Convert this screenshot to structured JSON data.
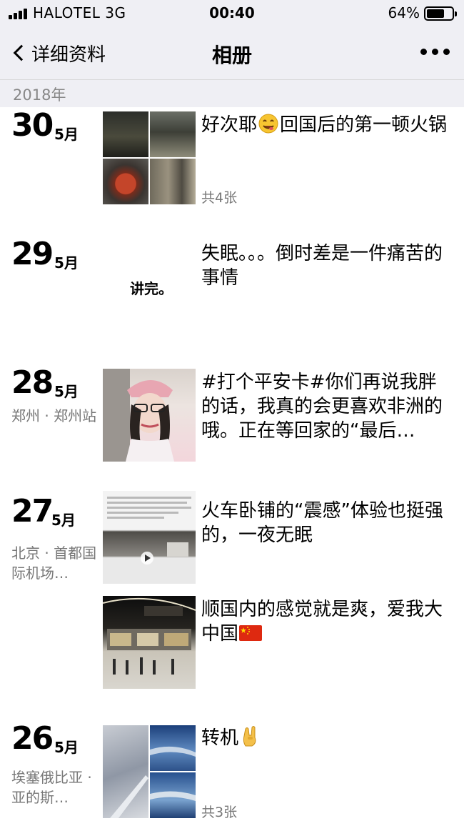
{
  "status_bar": {
    "carrier": "HALOTEL   3G",
    "time": "00:40",
    "battery": "64%"
  },
  "nav": {
    "back_label": "详细资料",
    "title": "相册"
  },
  "year": "2018年",
  "entries": [
    {
      "day": "30",
      "month": "5月",
      "location": "",
      "text": "好次耶",
      "text_after": "回国后的第一顿火锅",
      "count": "共4张"
    },
    {
      "day": "29",
      "month": "5月",
      "location": "",
      "text": "失眠。。。倒时差是一件痛苦的事情",
      "image_text": "讲完。"
    },
    {
      "day": "28",
      "month": "5月",
      "location": "郑州 · 郑州站",
      "text": "#打个平安卡#你们再说我胖的话，我真的会更喜欢非洲的哦。正在等回家的“最后…"
    },
    {
      "day": "27",
      "month": "5月",
      "location": "北京 · 首都国际机场…",
      "posts": [
        {
          "text": "火车卧铺的“震感”体验也挺强的，一夜无眠"
        },
        {
          "text": "顺国内的感觉就是爽，爱我大中国"
        }
      ]
    },
    {
      "day": "26",
      "month": "5月",
      "location": "埃塞俄比亚 · 亚的斯…",
      "text": "转机",
      "count": "共3张"
    }
  ]
}
